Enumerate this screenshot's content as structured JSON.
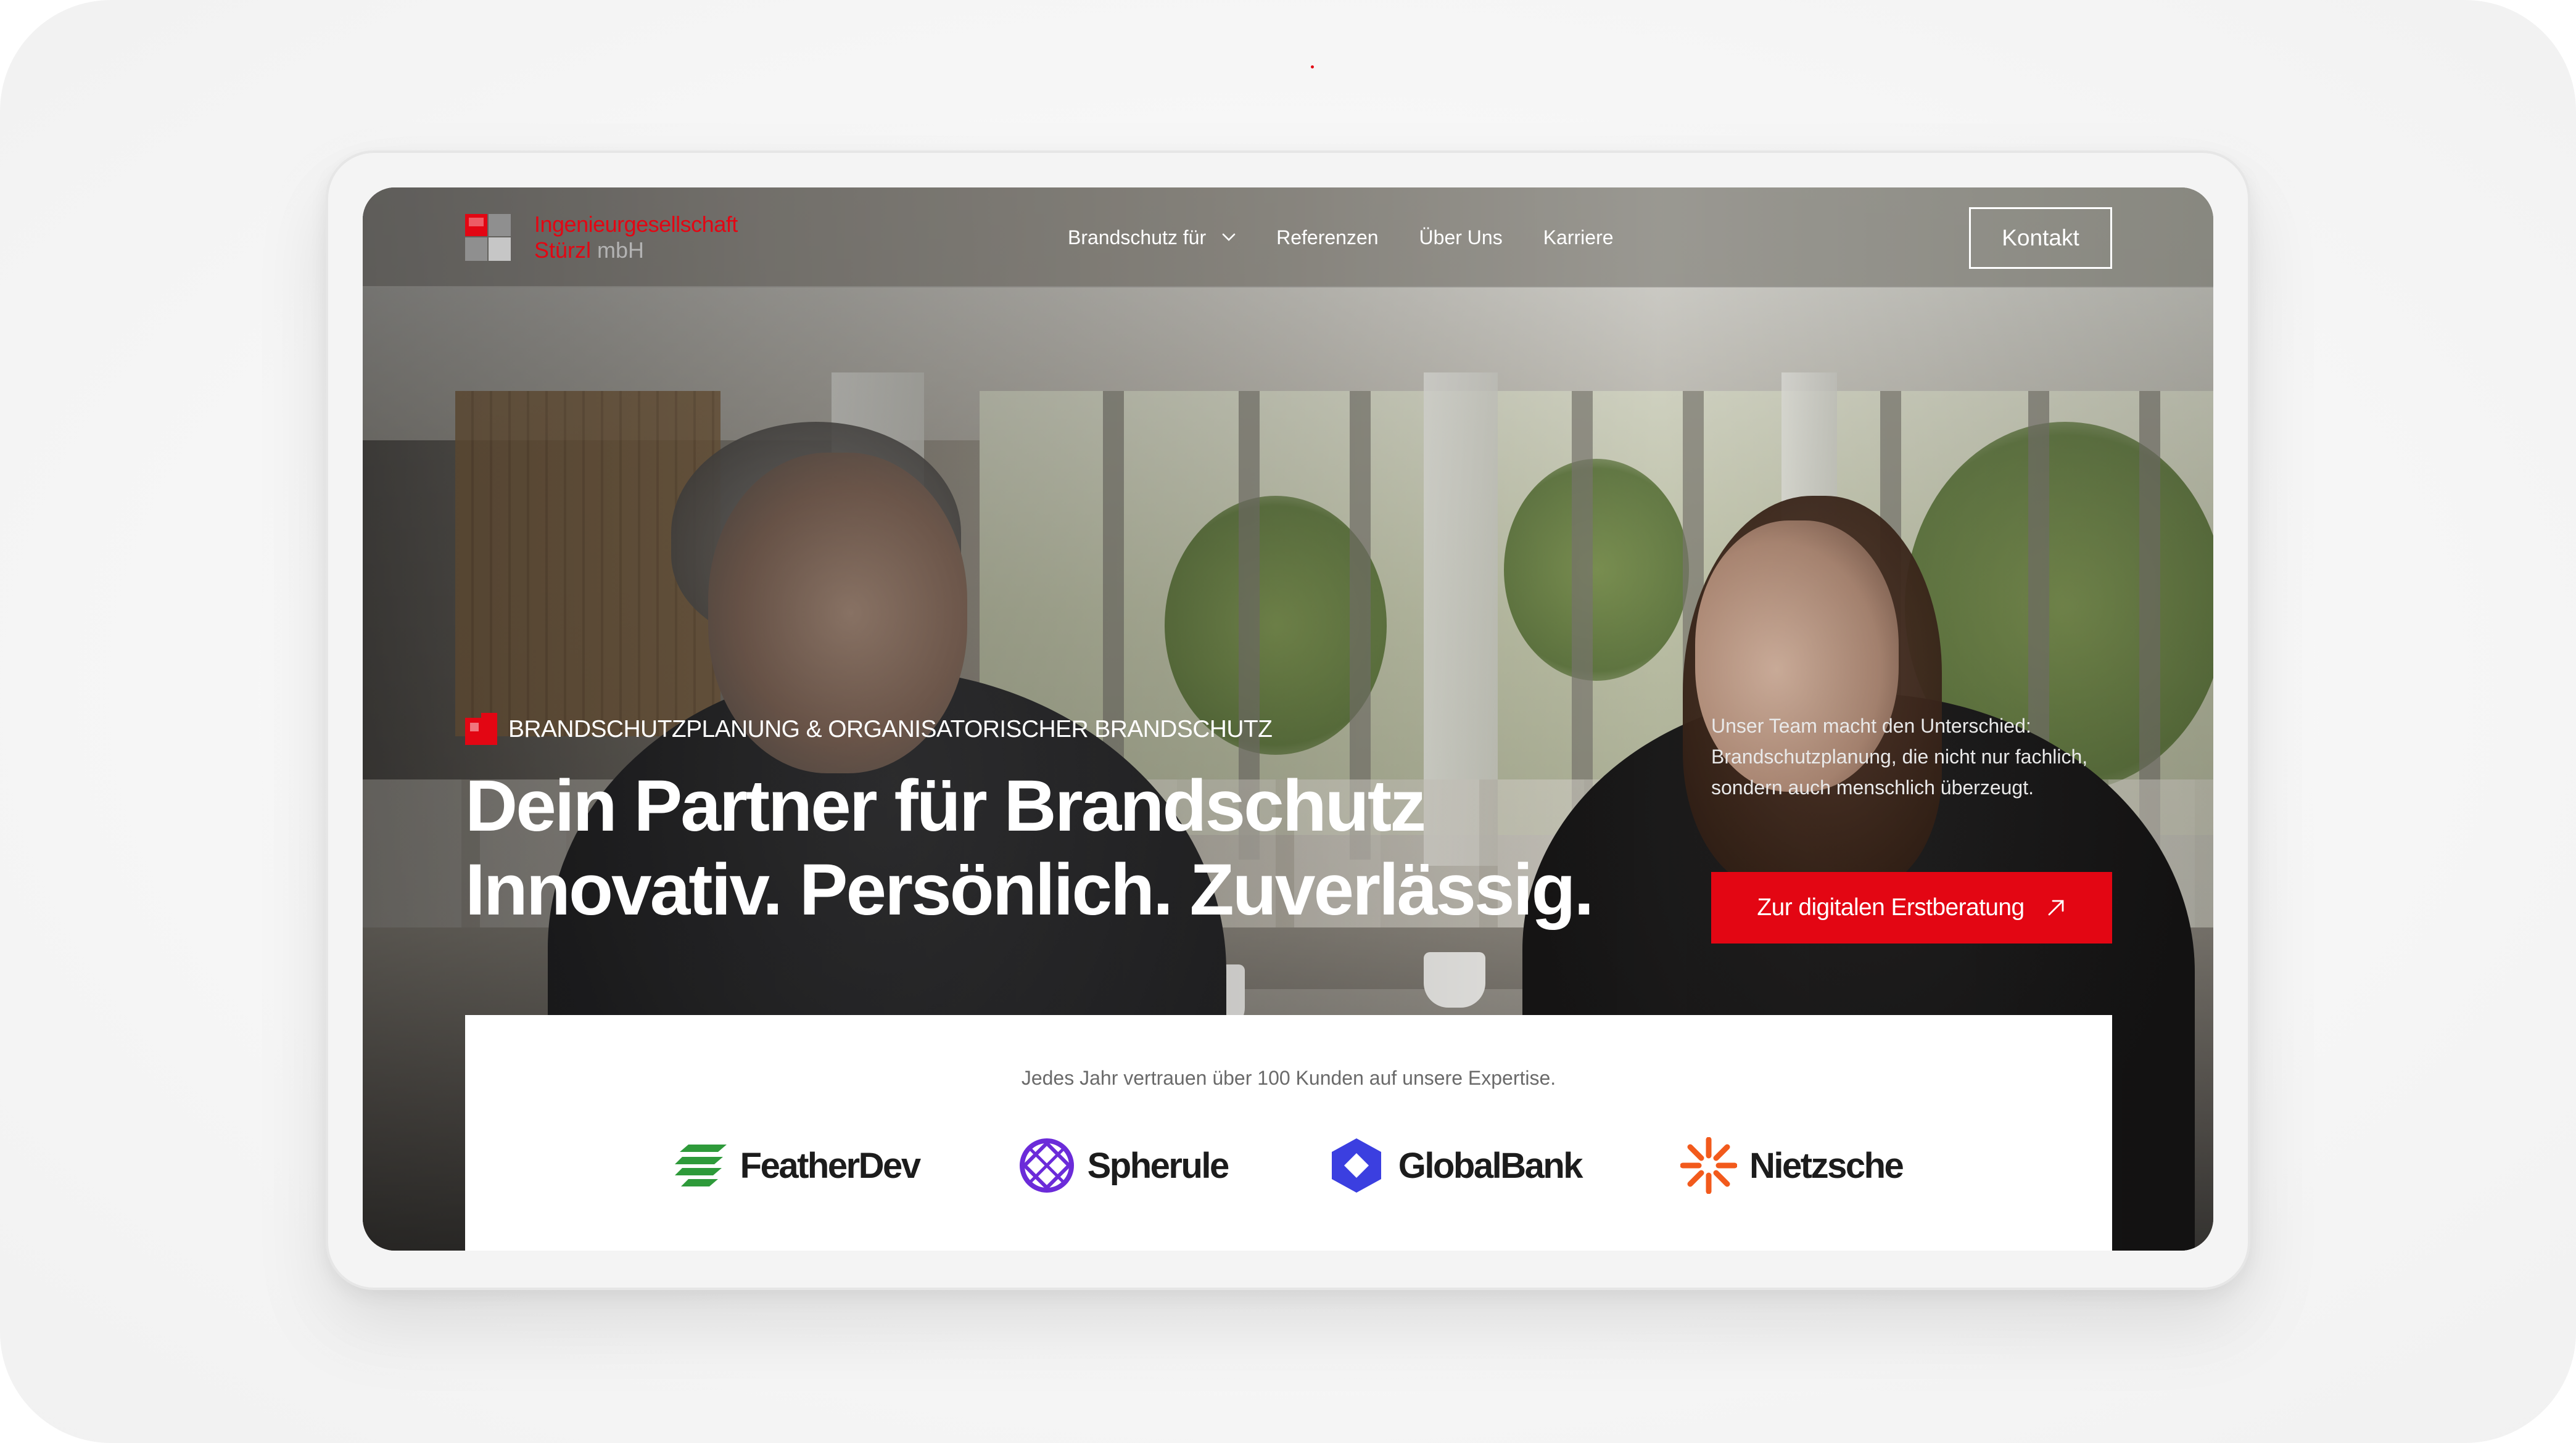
{
  "header": {
    "logo_line1": "Ingenieurgesellschaft",
    "logo_line2_name": "Stürzl",
    "logo_line2_suffix": "mbH",
    "nav": [
      {
        "label": "Brandschutz für",
        "has_dropdown": true
      },
      {
        "label": "Referenzen"
      },
      {
        "label": "Über Uns"
      },
      {
        "label": "Karriere"
      }
    ],
    "contact_label": "Kontakt"
  },
  "hero": {
    "eyebrow": "BRANDSCHUTZPLANUNG & ORGANISATORISCHER BRANDSCHUTZ",
    "headline_line1": "Dein Partner für Brandschutz",
    "headline_line2": "Innovativ. Persönlich. Zuverlässig.",
    "side_text": "Unser Team macht den Unterschied: Brandschutzplanung, die nicht nur fachlich, sondern auch menschlich überzeugt.",
    "cta_label": "Zur digitalen Erstberatung",
    "cta_icon": "arrow-up-right-icon"
  },
  "clients": {
    "caption": "Jedes Jahr vertrauen über 100 Kunden auf unsere Expertise.",
    "logos": [
      {
        "name": "FeatherDev",
        "icon": "featherdev-logo-icon",
        "color": "#2e9a3a"
      },
      {
        "name": "Spherule",
        "icon": "spherule-logo-icon",
        "color": "#6b2bd9"
      },
      {
        "name": "GlobalBank",
        "icon": "globalbank-logo-icon",
        "color": "#3b3fe0"
      },
      {
        "name": "Nietzsche",
        "icon": "nietzsche-logo-icon",
        "color": "#f25a1c"
      }
    ]
  },
  "colors": {
    "brand_red": "#e30613",
    "header_overlay": "rgba(120,118,114,0.55)",
    "text_white": "#ffffff"
  }
}
